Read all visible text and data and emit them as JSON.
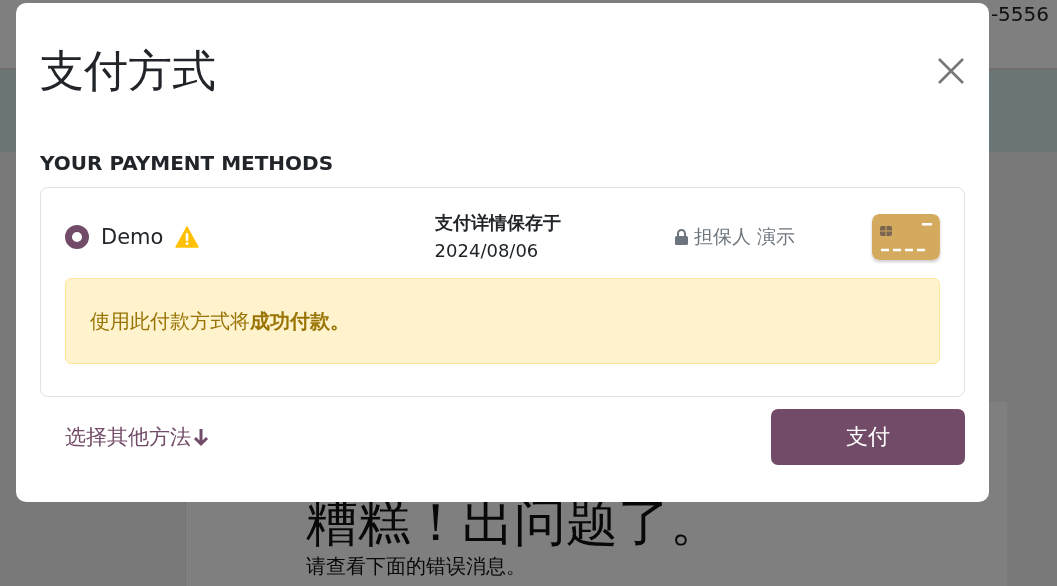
{
  "background": {
    "phone": "-5556",
    "heading": "糟糕！出问题了。",
    "message": "请查看下面的错误消息。"
  },
  "dialog": {
    "title": "支付方式",
    "section_title": "YOUR PAYMENT METHODS",
    "methods": [
      {
        "name": "Demo",
        "selected": true,
        "warning": true,
        "saved_label": "支付详情保存于",
        "saved_date": "2024/08/06",
        "secured_by": "担保人 演示",
        "alert": "使用此付款方式将**成功付款。**"
      }
    ],
    "other_methods_link": "选择其他方法",
    "pay_button": "支付"
  }
}
